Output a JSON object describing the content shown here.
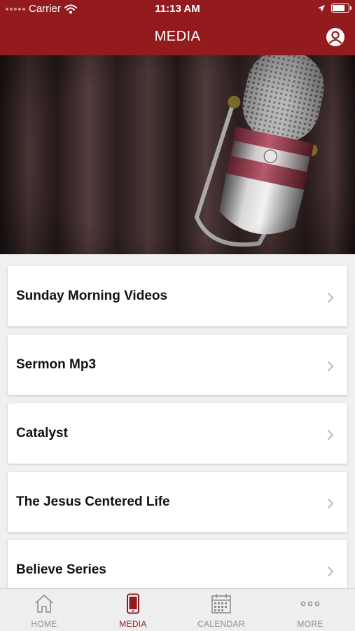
{
  "status_bar": {
    "carrier": "Carrier",
    "time": "11:13 AM",
    "battery_level": 0.9
  },
  "header": {
    "title": "MEDIA",
    "profile_icon": "profile-icon"
  },
  "hero": {
    "image": "vintage-microphone-photo"
  },
  "media_list": {
    "items": [
      {
        "label": "Sunday Morning Videos"
      },
      {
        "label": "Sermon Mp3"
      },
      {
        "label": "Catalyst"
      },
      {
        "label": "The Jesus Centered Life"
      },
      {
        "label": "Believe Series"
      }
    ]
  },
  "tab_bar": {
    "tabs": [
      {
        "label": "HOME",
        "icon": "home-icon"
      },
      {
        "label": "MEDIA",
        "icon": "phone-icon",
        "active": true
      },
      {
        "label": "CALENDAR",
        "icon": "calendar-icon"
      },
      {
        "label": "MORE",
        "icon": "more-dots-icon"
      }
    ]
  },
  "colors": {
    "brand": "#931b1e",
    "background": "#f0f0f2",
    "tab_inactive": "#8e8e93"
  }
}
